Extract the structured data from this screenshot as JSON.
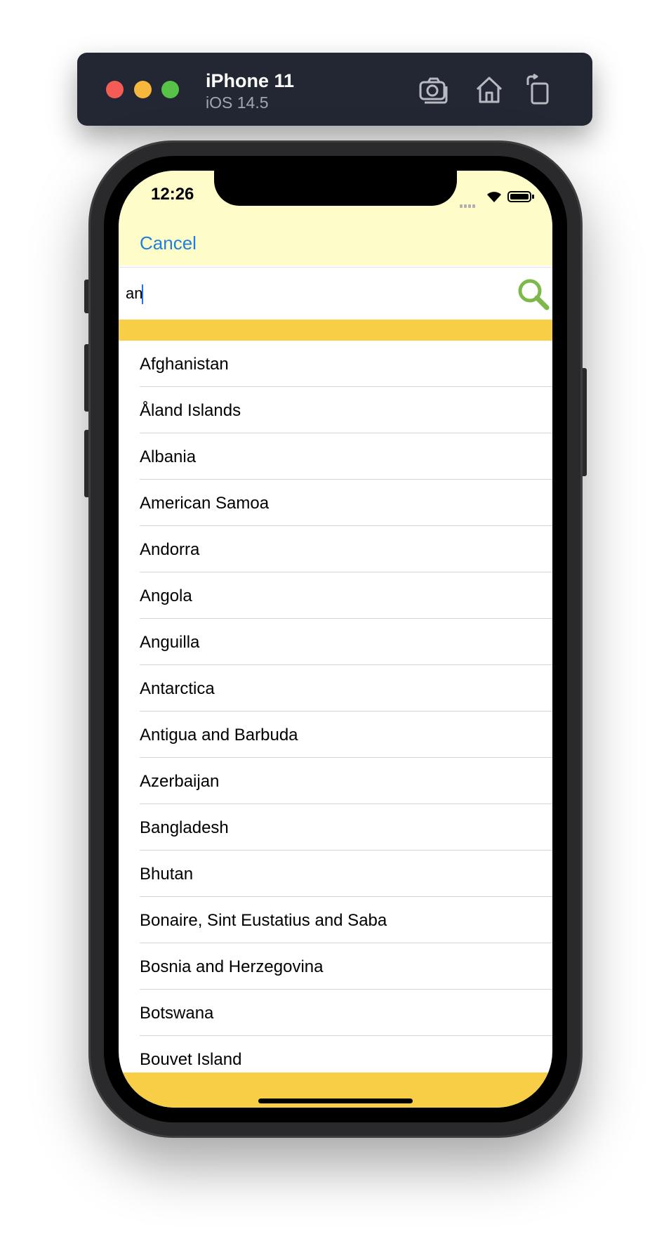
{
  "simulator": {
    "device_name": "iPhone 11",
    "os_version": "iOS 14.5",
    "icons": [
      "screenshot-icon",
      "home-icon",
      "rotate-icon"
    ]
  },
  "status_bar": {
    "time": "12:26"
  },
  "nav": {
    "cancel_label": "Cancel"
  },
  "search": {
    "value": "an",
    "icon": "search-icon"
  },
  "countries": [
    "Afghanistan",
    "Åland Islands",
    "Albania",
    "American Samoa",
    "Andorra",
    "Angola",
    "Anguilla",
    "Antarctica",
    "Antigua and Barbuda",
    "Azerbaijan",
    "Bangladesh",
    "Bhutan",
    "Bonaire, Sint Eustatius and Saba",
    "Bosnia and Herzegovina",
    "Botswana",
    "Bouvet Island"
  ],
  "colors": {
    "header_background": "#fefcc9",
    "accent_yellow": "#f8ce46",
    "cancel_blue": "#1f7fd9",
    "search_icon_green": "#7cb84a"
  }
}
